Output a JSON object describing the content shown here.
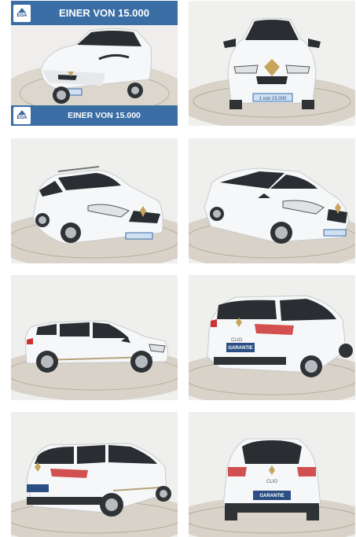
{
  "gallery": {
    "photos": [
      {
        "view": "front-left",
        "alt": "photo-1"
      },
      {
        "view": "front",
        "alt": "photo-2"
      },
      {
        "view": "front-left-3q",
        "alt": "photo-3"
      },
      {
        "view": "front-right-3q",
        "alt": "photo-4"
      },
      {
        "view": "side-right",
        "alt": "photo-5"
      },
      {
        "view": "rear-right-3q",
        "alt": "photo-6"
      },
      {
        "view": "rear-left-3q",
        "alt": "photo-7"
      },
      {
        "view": "rear",
        "alt": "photo-8"
      }
    ],
    "banner": {
      "logo_text": "EGA",
      "top_text": "EINER VON 15.000",
      "bottom_text": "EINER VON 15.000"
    },
    "plate_front": "1 von 15.000",
    "plate_rear": "GARANTIE",
    "badge_rear": "CLIO"
  },
  "colors": {
    "banner": "#3a6ea5",
    "car_body": "#f4f5f6",
    "window": "#2a2e33",
    "floor": "#d9d4cc",
    "wall": "#f0f0ef"
  }
}
